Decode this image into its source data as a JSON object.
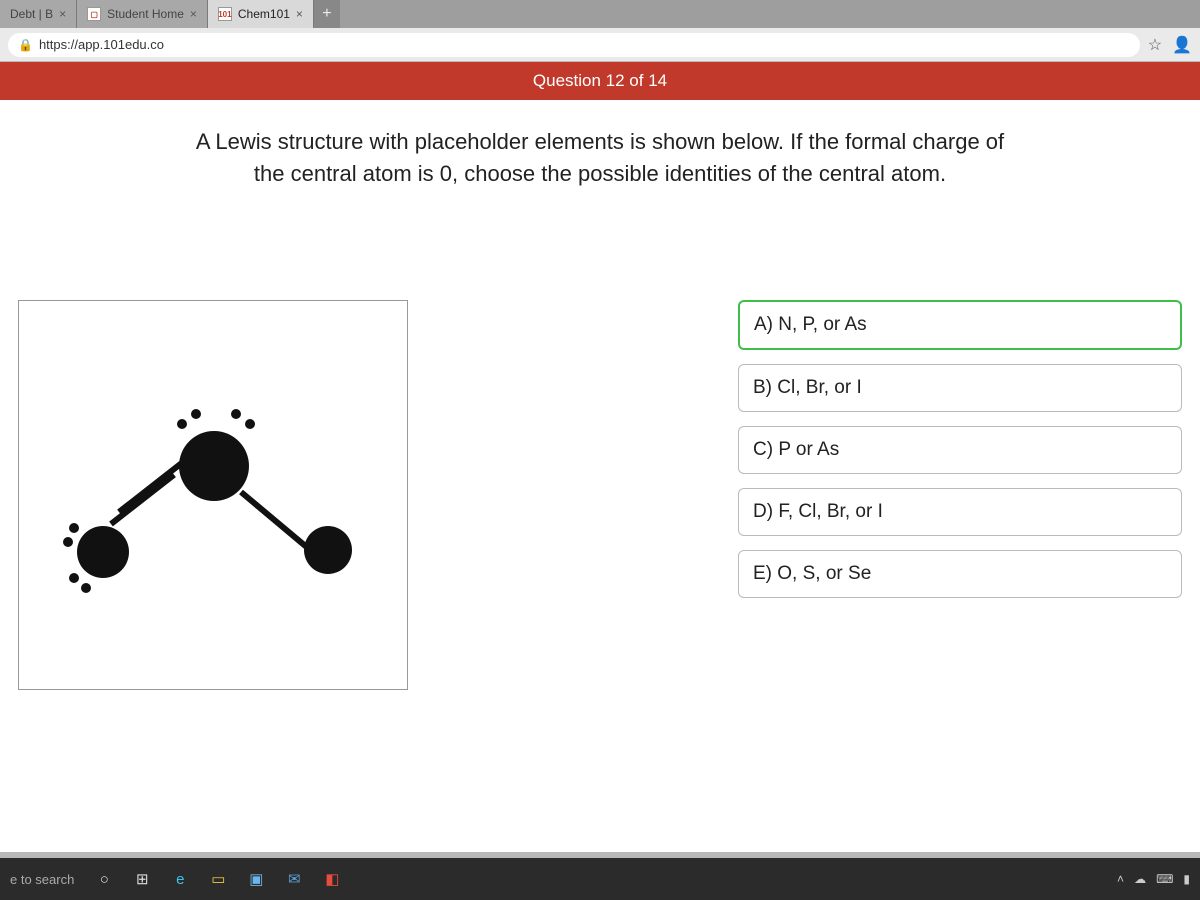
{
  "browser": {
    "tabs": [
      {
        "title": "Debt | B",
        "active": false
      },
      {
        "title": "Student Home",
        "active": false
      },
      {
        "title": "Chem101",
        "active": true,
        "favicon": "101"
      }
    ],
    "url": "https://app.101edu.co"
  },
  "quiz": {
    "progress_label": "Question 12 of 14",
    "prompt": "A Lewis structure with placeholder elements is shown below. If the formal charge of the central atom is 0, choose the possible identities of the central atom.",
    "answers": [
      {
        "label": "A) N, P, or As",
        "selected": true
      },
      {
        "label": "B) Cl, Br, or I",
        "selected": false
      },
      {
        "label": "C) P or As",
        "selected": false
      },
      {
        "label": "D) F, Cl, Br, or I",
        "selected": false
      },
      {
        "label": "E) O, S, or Se",
        "selected": false
      }
    ]
  },
  "taskbar": {
    "search_hint": "e to search"
  }
}
